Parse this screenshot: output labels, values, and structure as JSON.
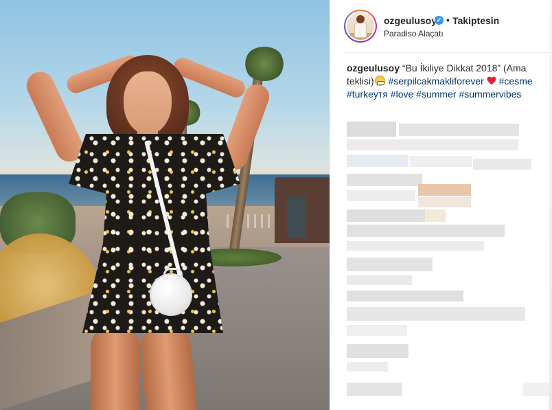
{
  "post": {
    "image_alt": "Woman in black floral romper posing on a seaside boardwalk at sunset",
    "header": {
      "username": "ozgeulusoy",
      "verified_mark": "✓",
      "separator": "•",
      "follow_label": "Takiptesin",
      "location": "Paradiso Alaçatı"
    },
    "caption": {
      "username": "ozgeulusoy",
      "text_part1": "“Bu İkiliye Dikkat 2018” (Ama teklisi)",
      "hashtags": {
        "t1": "#serpilcakmakliforever",
        "t2": "#cesme",
        "t3": "#turkeyтя",
        "t4": "#love",
        "t5": "#summer",
        "t6": "#summervibes"
      }
    },
    "colors": {
      "link": "#003569",
      "verified": "#3897f0",
      "heart": "#ed1c3b",
      "text": "#262626"
    },
    "icons": [
      "verified-badge-icon",
      "grimacing-emoji-icon",
      "red-heart-icon"
    ]
  }
}
